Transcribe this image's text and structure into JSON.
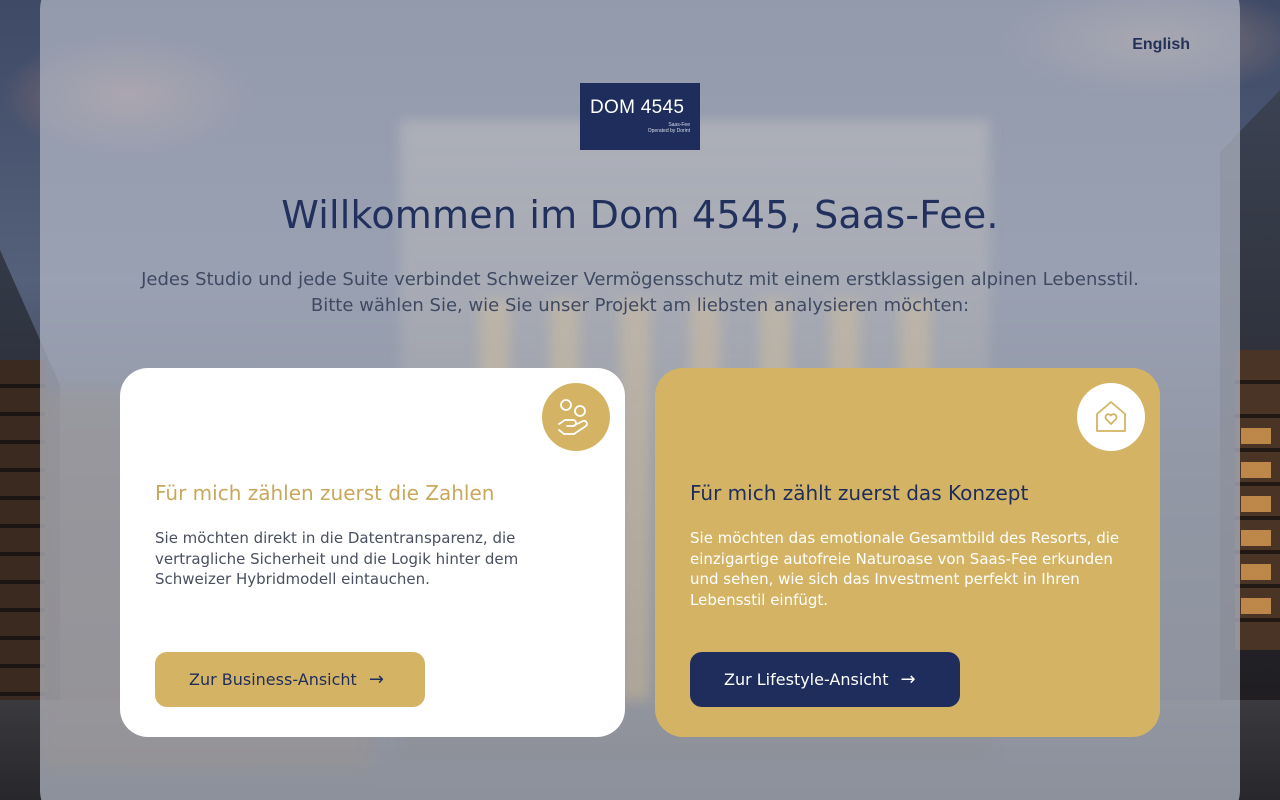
{
  "header": {
    "language_label": "English"
  },
  "logo": {
    "title": "DOM 4545",
    "sub_line1": "Saas-Fee",
    "sub_line2": "Operated by Dorint"
  },
  "hero": {
    "title": "Willkommen im Dom 4545, Saas-Fee.",
    "intro": "Jedes Studio und jede Suite verbindet Schweizer Vermögensschutz mit einem erstklassigen alpinen Lebensstil. Bitte wählen Sie, wie Sie unser Projekt am liebsten analysieren möchten:"
  },
  "cards": [
    {
      "icon": "hand-coins-icon",
      "title": "Für mich zählen zuerst die Zahlen",
      "text": "Sie möchten direkt in die Datentransparenz, die vertragliche Sicherheit und die Logik hinter dem Schweizer Hybridmodell eintauchen.",
      "button_label": "Zur Business-Ansicht",
      "arrow": "→"
    },
    {
      "icon": "house-heart-icon",
      "title": "Für mich zählt zuerst das Konzept",
      "text": "Sie möchten das emotionale Gesamtbild des Resorts, die einzigartige autofreie Naturoase von Saas-Fee erkunden und sehen, wie sich das Investment perfekt in Ihren Lebensstil einfügt.",
      "button_label": "Zur Lifestyle-Ansicht",
      "arrow": "→"
    }
  ],
  "colors": {
    "navy": "#1e2d5c",
    "gold": "#d4b464",
    "white": "#ffffff"
  }
}
